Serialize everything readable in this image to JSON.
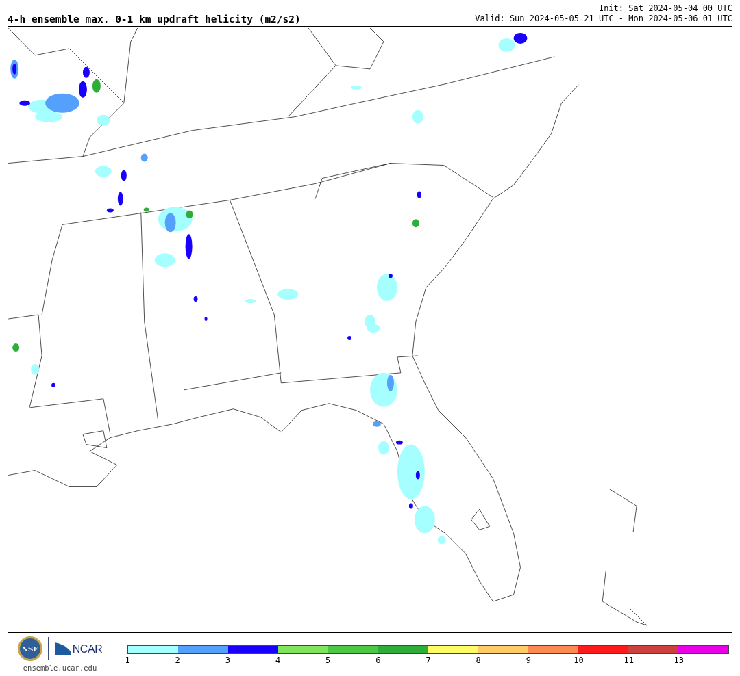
{
  "title": "4-h ensemble max. 0-1 km updraft helicity (m2/s2)",
  "init": "Init: Sat 2024-05-04 00 UTC",
  "valid": "Valid: Sun 2024-05-05 21 UTC - Mon 2024-05-06 01 UTC",
  "logos": {
    "nsf": "NSF",
    "ncar": "NCAR",
    "url": "ensemble.ucar.edu"
  },
  "colorbar": [
    {
      "label": "1",
      "color": "#a6ffff"
    },
    {
      "label": "2",
      "color": "#559ffd"
    },
    {
      "label": "3",
      "color": "#1900fd"
    },
    {
      "label": "4",
      "color": "#80e55c"
    },
    {
      "label": "5",
      "color": "#4cc844"
    },
    {
      "label": "6",
      "color": "#2fad39"
    },
    {
      "label": "7",
      "color": "#fdfc64"
    },
    {
      "label": "8",
      "color": "#fdcb69"
    },
    {
      "label": "9",
      "color": "#fd8a50"
    },
    {
      "label": "10",
      "color": "#fd1a1a"
    },
    {
      "label": "11",
      "color": "#cc4040"
    },
    {
      "label": "13",
      "color": "#e800e8"
    }
  ]
}
